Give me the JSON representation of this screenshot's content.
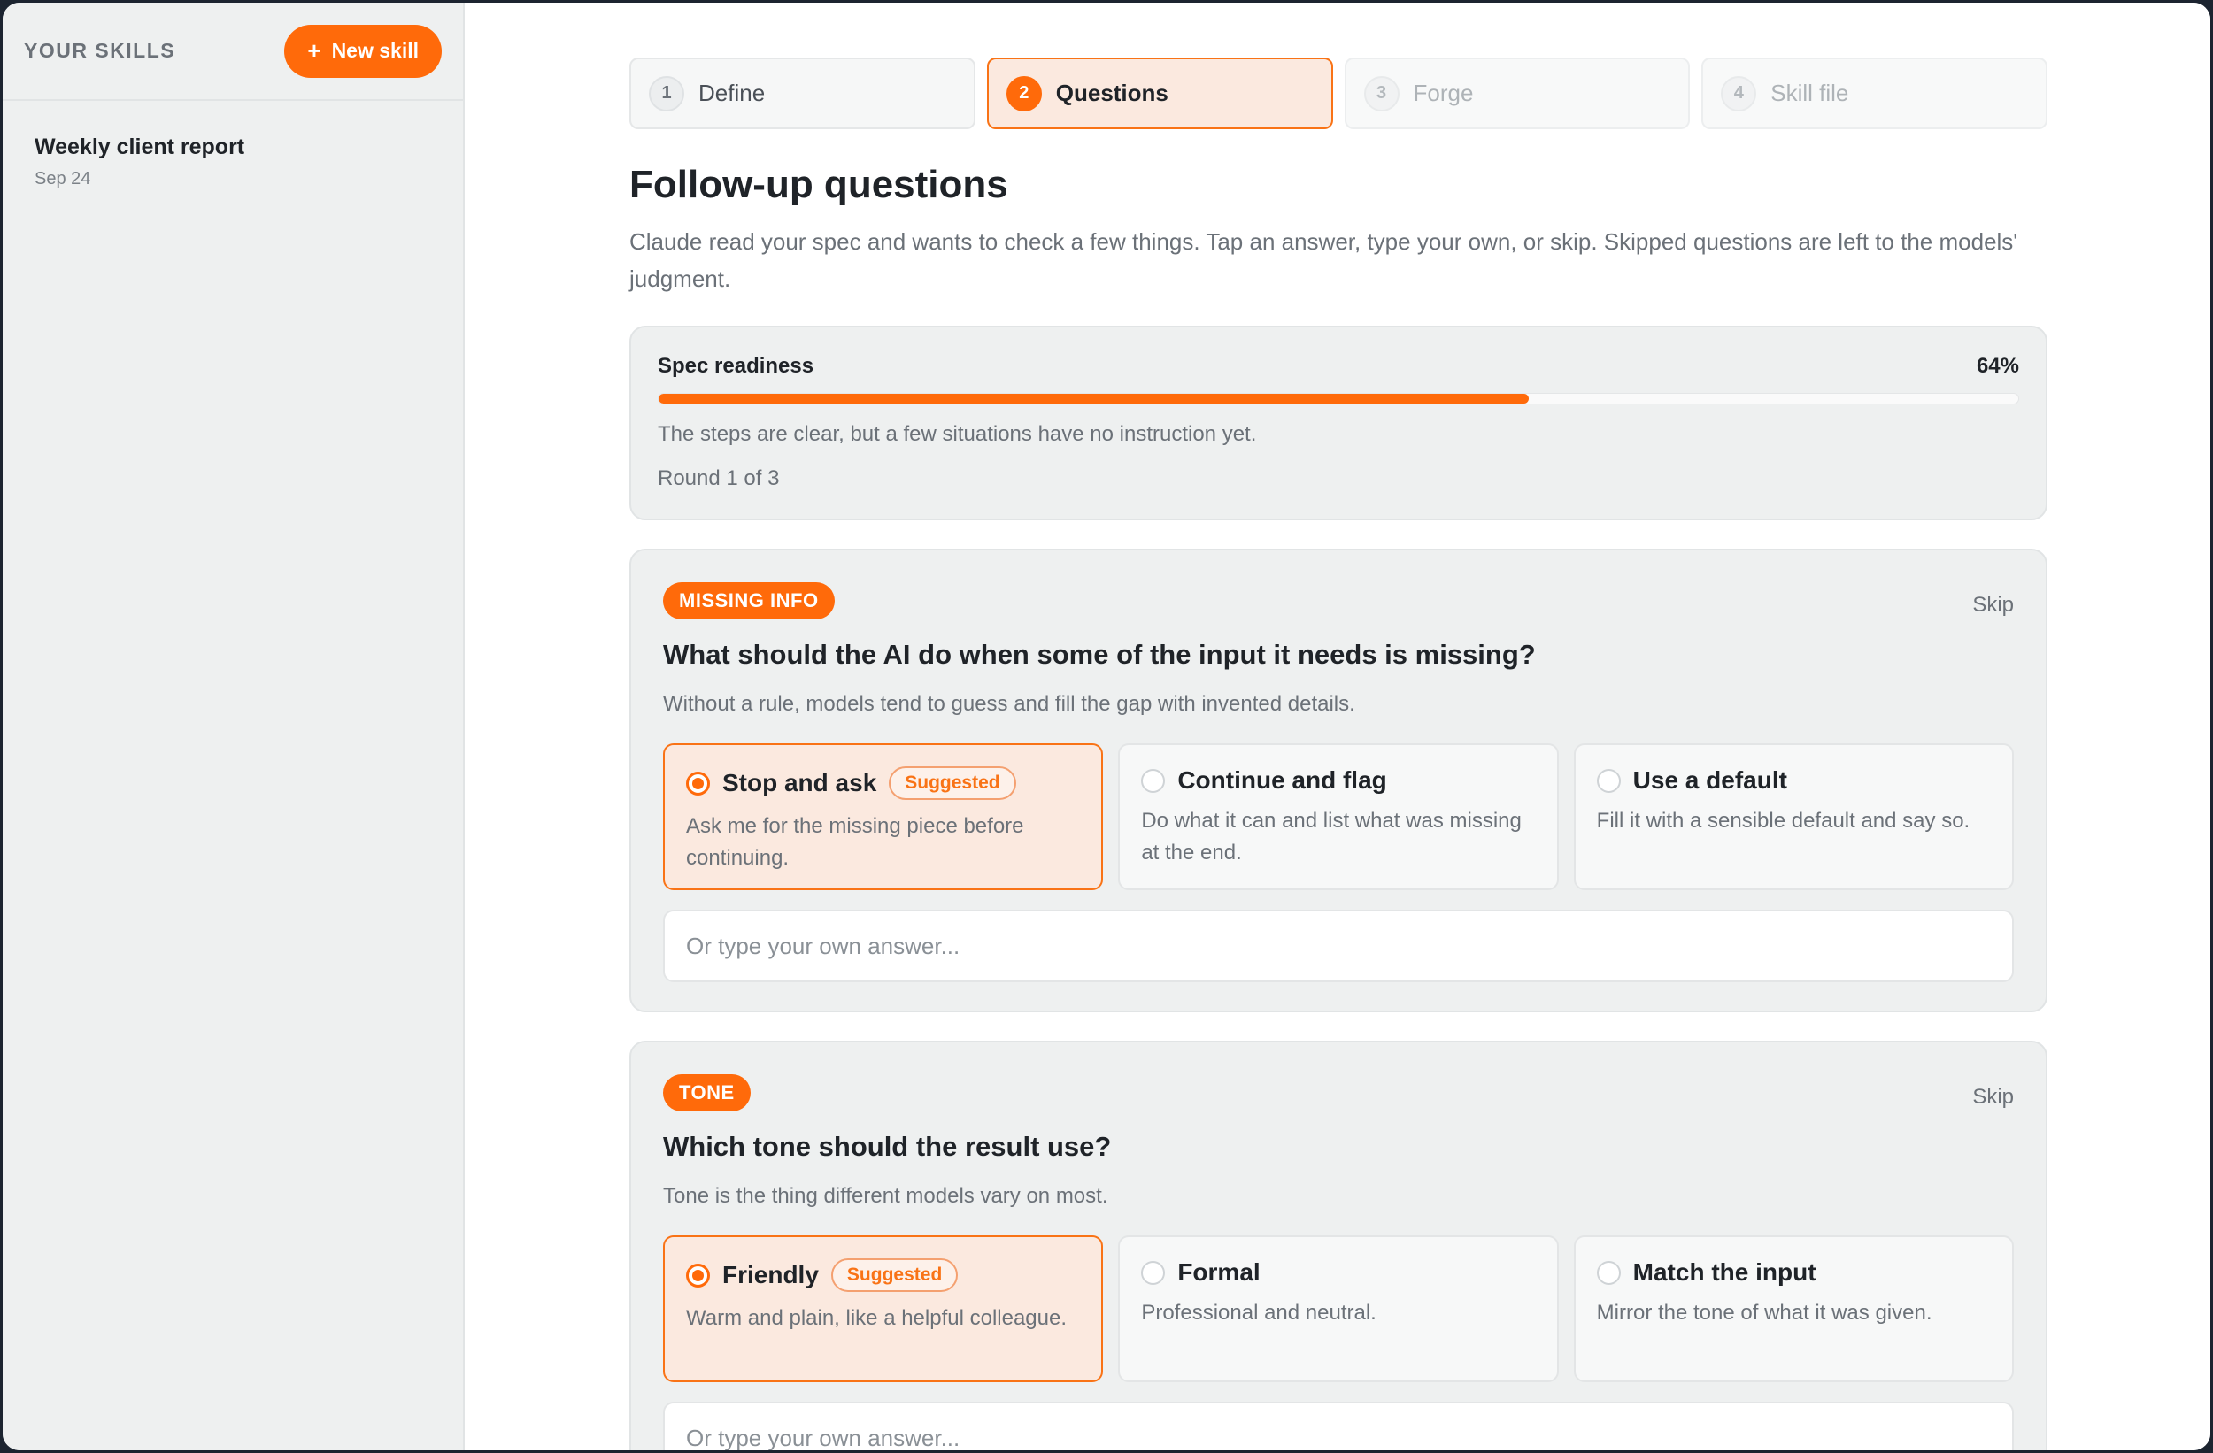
{
  "sidebar": {
    "title": "YOUR SKILLS",
    "new_skill_label": "New skill",
    "items": [
      {
        "name": "Weekly client report",
        "date": "Sep 24"
      }
    ]
  },
  "steps": [
    {
      "num": "1",
      "label": "Define",
      "state": "done"
    },
    {
      "num": "2",
      "label": "Questions",
      "state": "active"
    },
    {
      "num": "3",
      "label": "Forge",
      "state": "disabled"
    },
    {
      "num": "4",
      "label": "Skill file",
      "state": "disabled"
    }
  ],
  "page": {
    "title": "Follow-up questions",
    "description": "Claude read your spec and wants to check a few things. Tap an answer, type your own, or skip. Skipped questions are left to the models' judgment."
  },
  "readiness": {
    "label": "Spec readiness",
    "percent_label": "64%",
    "percent": 64,
    "note": "The steps are clear, but a few situations have no instruction yet.",
    "round": "Round 1 of 3"
  },
  "questions": [
    {
      "tag": "MISSING INFO",
      "skip_label": "Skip",
      "title": "What should the AI do when some of the input it needs is missing?",
      "subtitle": "Without a rule, models tend to guess and fill the gap with invented details.",
      "options": [
        {
          "title": "Stop and ask",
          "badge": "Suggested",
          "desc": "Ask me for the missing piece before continuing.",
          "selected": true
        },
        {
          "title": "Continue and flag",
          "badge": "",
          "desc": "Do what it can and list what was missing at the end.",
          "selected": false
        },
        {
          "title": "Use a default",
          "badge": "",
          "desc": "Fill it with a sensible default and say so.",
          "selected": false
        }
      ],
      "own_placeholder": "Or type your own answer..."
    },
    {
      "tag": "TONE",
      "skip_label": "Skip",
      "title": "Which tone should the result use?",
      "subtitle": "Tone is the thing different models vary on most.",
      "options": [
        {
          "title": "Friendly",
          "badge": "Suggested",
          "desc": "Warm and plain, like a helpful colleague.",
          "selected": true
        },
        {
          "title": "Formal",
          "badge": "",
          "desc": "Professional and neutral.",
          "selected": false
        },
        {
          "title": "Match the input",
          "badge": "",
          "desc": "Mirror the tone of what it was given.",
          "selected": false
        }
      ],
      "own_placeholder": "Or type your own answer..."
    }
  ],
  "colors": {
    "accent": "#ff6a0a",
    "selected_bg": "#fbe9df",
    "sidebar_bg": "#eef0f0"
  }
}
